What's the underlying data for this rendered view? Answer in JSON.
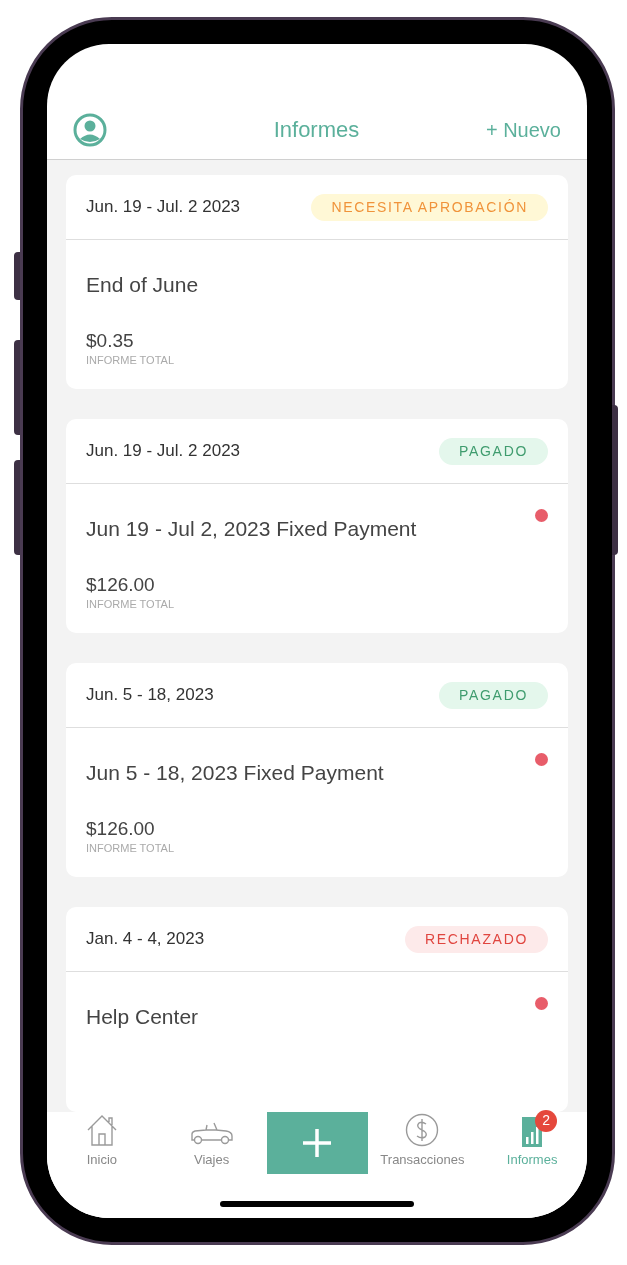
{
  "header": {
    "title": "Informes",
    "new_button": "+ Nuevo"
  },
  "reports": [
    {
      "dates": "Jun. 19 - Jul. 2 2023",
      "status": {
        "kind": "needs_approval",
        "label": "NECESITA APROBACIÓN"
      },
      "title": "End of June",
      "unread": false,
      "amount": "$0.35",
      "amount_label": "INFORME TOTAL"
    },
    {
      "dates": "Jun. 19 - Jul. 2 2023",
      "status": {
        "kind": "paid",
        "label": "PAGADO"
      },
      "title": "Jun 19 - Jul 2, 2023 Fixed Payment",
      "unread": true,
      "amount": "$126.00",
      "amount_label": "INFORME TOTAL"
    },
    {
      "dates": "Jun. 5 - 18, 2023",
      "status": {
        "kind": "paid",
        "label": "PAGADO"
      },
      "title": "Jun 5 - 18, 2023 Fixed Payment",
      "unread": true,
      "amount": "$126.00",
      "amount_label": "INFORME TOTAL"
    },
    {
      "dates": "Jan. 4 - 4, 2023",
      "status": {
        "kind": "rejected",
        "label": "RECHAZADO"
      },
      "title": "Help Center",
      "unread": true
    }
  ],
  "tab_bar": [
    {
      "kind": "tab",
      "label": "Inicio",
      "selected": false
    },
    {
      "kind": "tab",
      "label": "Viajes",
      "selected": false
    },
    {
      "kind": "action"
    },
    {
      "kind": "tab",
      "label": "Transacciones",
      "selected": false
    },
    {
      "kind": "tab",
      "label": "Informes",
      "selected": true,
      "badge": "2"
    }
  ]
}
